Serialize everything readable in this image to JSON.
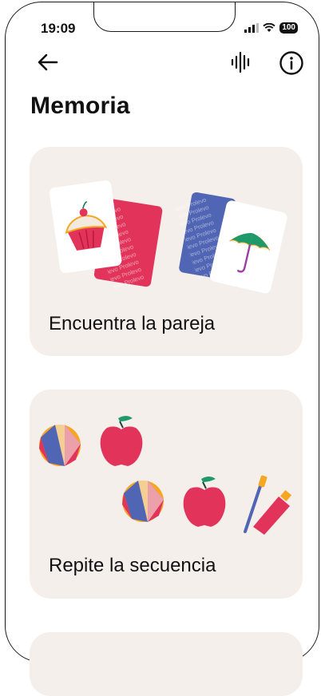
{
  "status_bar": {
    "time": "19:09",
    "battery": "100"
  },
  "page": {
    "title": "Memoria"
  },
  "games": [
    {
      "label": "Encuentra la pareja",
      "pattern_text": "Prolevo Prolevo Prolevo"
    },
    {
      "label": "Repite la secuencia"
    }
  ],
  "colors": {
    "card_bg": "#f5efeb",
    "card_pattern_red": "#e2335a",
    "card_pattern_blue": "#5065b4"
  },
  "icons": {
    "back": "arrow-left-icon",
    "audio": "sound-wave-icon",
    "info": "info-circle-icon"
  }
}
